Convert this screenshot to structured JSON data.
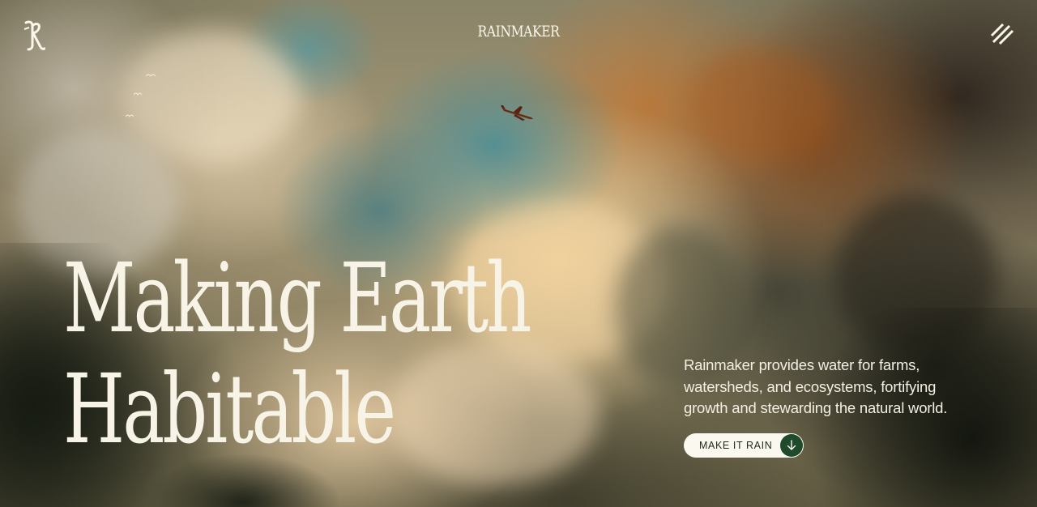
{
  "header": {
    "logo_alt": "rk-monogram-logo",
    "brand": "RAINMAKER",
    "menu_icon": "diagonal-lines-menu-icon"
  },
  "hero": {
    "headline_line1": "Making Earth",
    "headline_line2": "Habitable",
    "description": "Rainmaker provides water for farms, watersheds, and ecosystems, fortifying growth and stewarding the natural world.",
    "cta_label": "MAKE IT RAIN",
    "cta_icon": "arrow-down-icon",
    "background": "painted-cloudscape-with-airplane"
  },
  "colors": {
    "text_light": "#f8f3e7",
    "button_bg": "#fbf8f0",
    "button_icon_bg": "#1f4a2c",
    "button_text": "#1f2a1f"
  }
}
